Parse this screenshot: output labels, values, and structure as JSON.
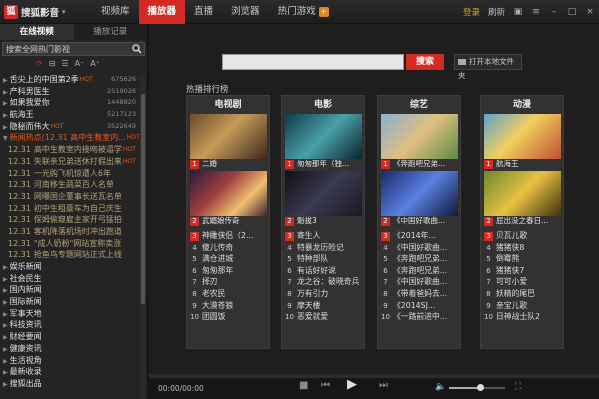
{
  "app": {
    "logo_text": "搜狐影音",
    "nav": [
      "视频库",
      "播放器",
      "直播",
      "浏览器",
      "热门游戏"
    ],
    "active_nav": 1,
    "login": "登录",
    "refresh": "刷新",
    "colors": {
      "accent": "#d42a25",
      "hot": "#e35a1a",
      "gold": "#d0a33b"
    }
  },
  "sidebar": {
    "tabs": [
      "在线视频",
      "播放记录"
    ],
    "search_placeholder": "搜索全网热门影视",
    "items": [
      {
        "type": "item",
        "label": "舌尖上的中国第2季",
        "hot": "HOT",
        "num": "675626"
      },
      {
        "type": "item",
        "label": "产科男医生",
        "hot": "",
        "num": "2519026"
      },
      {
        "type": "item",
        "label": "如果我爱你",
        "hot": "",
        "num": "1448820"
      },
      {
        "type": "item",
        "label": "航海王",
        "hot": "",
        "num": "5217123"
      },
      {
        "type": "item",
        "label": "隐秘而伟大",
        "hot": "HOT",
        "num": "3522649"
      },
      {
        "type": "open",
        "label": "新闻热点(12.31 高中生教室内...",
        "hot": "HOT",
        "num": ""
      },
      {
        "type": "sub",
        "date": "12.31",
        "label": "高中生教室内接吻被逼学",
        "hot": "HOT"
      },
      {
        "type": "sub",
        "date": "12.31",
        "label": "失联亲兄弟送休打假出来",
        "hot": "HOT"
      },
      {
        "type": "sub",
        "date": "12.31",
        "label": "一元购飞机惊遭人6年",
        "hot": ""
      },
      {
        "type": "sub",
        "date": "12.31",
        "label": "河南移生蔬菜百人名单",
        "hot": ""
      },
      {
        "type": "sub",
        "date": "12.31",
        "label": "网曝国企董事长送瓦名单",
        "hot": ""
      },
      {
        "type": "sub",
        "date": "12.31",
        "label": "初中生租豪车为自己庆生",
        "hot": ""
      },
      {
        "type": "sub",
        "date": "12.31",
        "label": "保姆偷窥雇主家开弓猛拍",
        "hot": ""
      },
      {
        "type": "sub",
        "date": "12.31",
        "label": "客机降落机场时冲出跑道",
        "hot": ""
      },
      {
        "type": "sub",
        "date": "12.31",
        "label": "\"成人奶粉\"网站宣称卖涨",
        "hot": ""
      },
      {
        "type": "sub",
        "date": "12.31",
        "label": "抢鱼鸟专题网站正式上线",
        "hot": ""
      },
      {
        "type": "section",
        "label": "娱乐新闻"
      },
      {
        "type": "section",
        "label": "社会民生"
      },
      {
        "type": "section",
        "label": "国内新闻"
      },
      {
        "type": "section",
        "label": "国际新闻"
      },
      {
        "type": "section",
        "label": "军事天地"
      },
      {
        "type": "section",
        "label": "科技资讯"
      },
      {
        "type": "section",
        "label": "财经要闻"
      },
      {
        "type": "section",
        "label": "健康资讯"
      },
      {
        "type": "section",
        "label": "生活视角"
      },
      {
        "type": "section",
        "label": "最新收录"
      },
      {
        "type": "section",
        "label": "搜狐出品"
      }
    ]
  },
  "main": {
    "search_button": "搜索",
    "open_folder": "打开本地文件夹",
    "rank_title": "热播排行榜",
    "columns": [
      {
        "title": "电视剧",
        "cards": [
          {
            "rank": "1",
            "caption": "二婚"
          },
          {
            "rank": "2",
            "caption": "武媚娘传奇"
          }
        ],
        "list": [
          {
            "rank": "3",
            "title": "神雕侠侣（2..."
          },
          {
            "rank": "4",
            "title": "傻儿传奇"
          },
          {
            "rank": "5",
            "title": "满仓进城"
          },
          {
            "rank": "6",
            "title": "匆匆那年"
          },
          {
            "rank": "7",
            "title": "择刃"
          },
          {
            "rank": "8",
            "title": "老农民"
          },
          {
            "rank": "9",
            "title": "大漠苍狼"
          },
          {
            "rank": "10",
            "title": "团圆饭"
          }
        ]
      },
      {
        "title": "电影",
        "cards": [
          {
            "rank": "1",
            "caption": "匆匆那年（独..."
          },
          {
            "rank": "2",
            "caption": "魁拔3"
          }
        ],
        "list": [
          {
            "rank": "3",
            "title": "寄生人"
          },
          {
            "rank": "4",
            "title": "特暴龙历险记"
          },
          {
            "rank": "5",
            "title": "特种部队"
          },
          {
            "rank": "6",
            "title": "有话好好说"
          },
          {
            "rank": "7",
            "title": "龙之谷：破晓奇兵"
          },
          {
            "rank": "8",
            "title": "万有引力"
          },
          {
            "rank": "9",
            "title": "摩天楼"
          },
          {
            "rank": "10",
            "title": "恶爱就爱"
          }
        ]
      },
      {
        "title": "综艺",
        "cards": [
          {
            "rank": "1",
            "caption": "《奔跑吧兄弟..."
          },
          {
            "rank": "2",
            "caption": "《中国好歌曲..."
          }
        ],
        "list": [
          {
            "rank": "3",
            "title": "《2014年..."
          },
          {
            "rank": "4",
            "title": "《中国好歌曲..."
          },
          {
            "rank": "5",
            "title": "《奔跑吧兄弟..."
          },
          {
            "rank": "6",
            "title": "《奔跑吧兄弟..."
          },
          {
            "rank": "7",
            "title": "《中国好歌曲..."
          },
          {
            "rank": "8",
            "title": "《带着爸妈去..."
          },
          {
            "rank": "9",
            "title": "《2014SJ..."
          },
          {
            "rank": "10",
            "title": "《一路前进中..."
          }
        ]
      },
      {
        "title": "动漫",
        "cards": [
          {
            "rank": "1",
            "caption": "航海王"
          },
          {
            "rank": "2",
            "caption": "屁出没之春日..."
          }
        ],
        "list": [
          {
            "rank": "3",
            "title": "贝瓦儿歌"
          },
          {
            "rank": "4",
            "title": "猪猪侠8"
          },
          {
            "rank": "5",
            "title": "倒霉熊"
          },
          {
            "rank": "6",
            "title": "猪猪侠7"
          },
          {
            "rank": "7",
            "title": "可可小爱"
          },
          {
            "rank": "8",
            "title": "妖精的尾巴"
          },
          {
            "rank": "9",
            "title": "亲宝儿歌"
          },
          {
            "rank": "10",
            "title": "日神战士队2"
          }
        ]
      }
    ]
  },
  "player": {
    "time": "00:00/00:00",
    "volume": 0.55
  }
}
